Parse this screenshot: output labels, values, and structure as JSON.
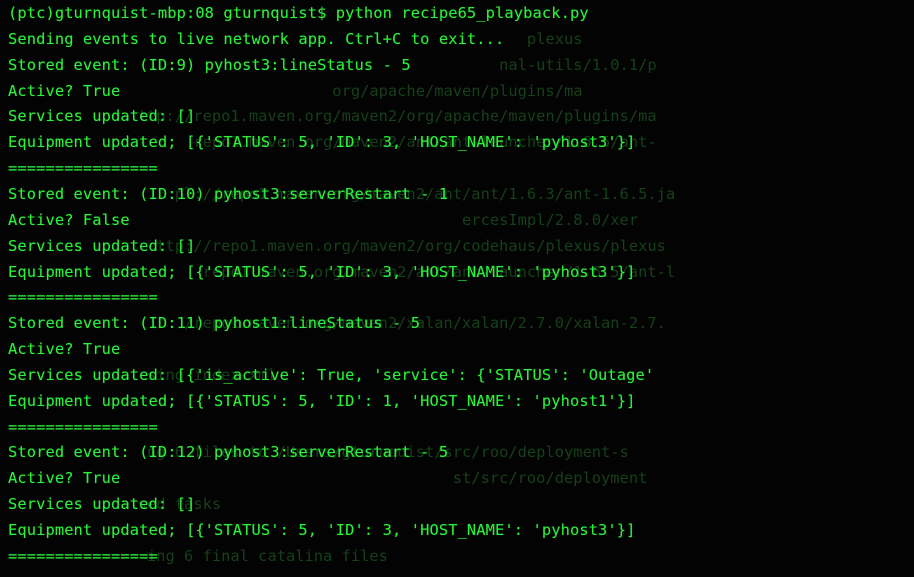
{
  "terminal": {
    "colors": {
      "background": "#020302",
      "foreground": "#2cf03b",
      "ghost_text": "#16401a"
    },
    "lines": [
      "(ptc)gturnquist-mbp:08 gturnquist$ python recipe65_playback.py",
      "Sending events to live network app. Ctrl+C to exit...",
      "Stored event: (ID:9) pyhost3:lineStatus - 5",
      "Active? True",
      "Services updated: []",
      "Equipment updated; [{'STATUS': 5, 'ID': 3, 'HOST_NAME': 'pyhost3'}]",
      "================",
      "Stored event: (ID:10) pyhost3:serverRestart - 1",
      "Active? False",
      "Services updated: []",
      "Equipment updated; [{'STATUS': 5, 'ID': 3, 'HOST_NAME': 'pyhost3'}]",
      "================",
      "Stored event: (ID:11) pyhost1:lineStatus - 5",
      "Active? True",
      "Services updated: [{'is_active': True, 'service': {'STATUS': 'Outage'",
      "Equipment updated; [{'STATUS': 5, 'ID': 1, 'HOST_NAME': 'pyhost1'}]",
      "================",
      "Stored event: (ID:12) pyhost3:serverRestart - 5",
      "Active? True",
      "Services updated: []",
      "Equipment updated; [{'STATUS': 5, 'ID': 3, 'HOST_NAME': 'pyhost3'}]",
      "================"
    ],
    "ghost_lines": [
      "",
      "                                                        plexus",
      "                                                     nal-utils/1.0.1/p",
      "                                   org/apache/maven/plugins/ma",
      "              ttp://repo1.maven.org/maven2/org/apache/maven/plugins/ma",
      "                    repo1.maven.org/maven2/ant/ant-launcher/1.6.5/ant-",
      "",
      "                  pl://repo1.maven.org/maven2/ant/ant/1.6.3/ant-1.6.5.ja",
      "                                                 ercesImpl/2.8.0/xer",
      "                ttp://repo1.maven.org/maven2/org/codehaus/plexus/plexus",
      "                     repo1.maven.org/maven2/ant/ant-launcher/1.6.5/ant-l",
      "",
      "                   /repo1.maven.org/maven2/xalan/xalan/2.7.0/xalan-2.7.",
      "",
      "               sing index.xml",
      "",
      "",
      "               ng 6 files to /Users/gturnquist/src/roo/deployment-s",
      "                                                st/src/roo/deployment",
      "              sed tasks",
      "",
      "               ing 6 final catalina files"
    ]
  }
}
